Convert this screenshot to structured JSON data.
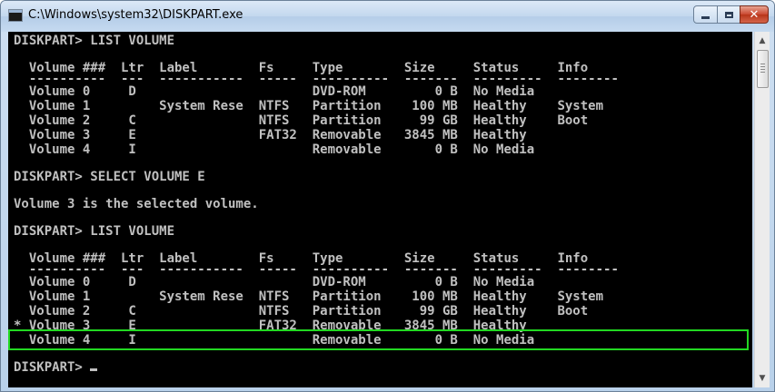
{
  "window": {
    "title": "C:\\Windows\\system32\\DISKPART.exe",
    "close_glyph": "✕"
  },
  "scrollbar": {
    "up_arrow": "▲",
    "down_arrow": "▼"
  },
  "console": {
    "lines": [
      "DISKPART> LIST VOLUME",
      "",
      "  Volume ###  Ltr  Label        Fs     Type        Size     Status     Info",
      "  ----------  ---  -----------  -----  ----------  -------  ---------  --------",
      "  Volume 0     D                       DVD-ROM         0 B  No Media",
      "  Volume 1         System Rese  NTFS   Partition    100 MB  Healthy    System",
      "  Volume 2     C                NTFS   Partition     99 GB  Healthy    Boot",
      "  Volume 3     E                FAT32  Removable   3845 MB  Healthy",
      "  Volume 4     I                       Removable       0 B  No Media",
      "",
      "DISKPART> SELECT VOLUME E",
      "",
      "Volume 3 is the selected volume.",
      "",
      "DISKPART> LIST VOLUME",
      "",
      "  Volume ###  Ltr  Label        Fs     Type        Size     Status     Info",
      "  ----------  ---  -----------  -----  ----------  -------  ---------  --------",
      "  Volume 0     D                       DVD-ROM         0 B  No Media",
      "  Volume 1         System Rese  NTFS   Partition    100 MB  Healthy    System",
      "  Volume 2     C                NTFS   Partition     99 GB  Healthy    Boot",
      "* Volume 3     E                FAT32  Removable   3845 MB  Healthy",
      "  Volume 4     I                       Removable       0 B  No Media",
      "",
      "DISKPART> "
    ]
  },
  "colors": {
    "console_bg": "#000000",
    "console_text": "#c0c0c0",
    "highlight_border": "#22d822"
  }
}
